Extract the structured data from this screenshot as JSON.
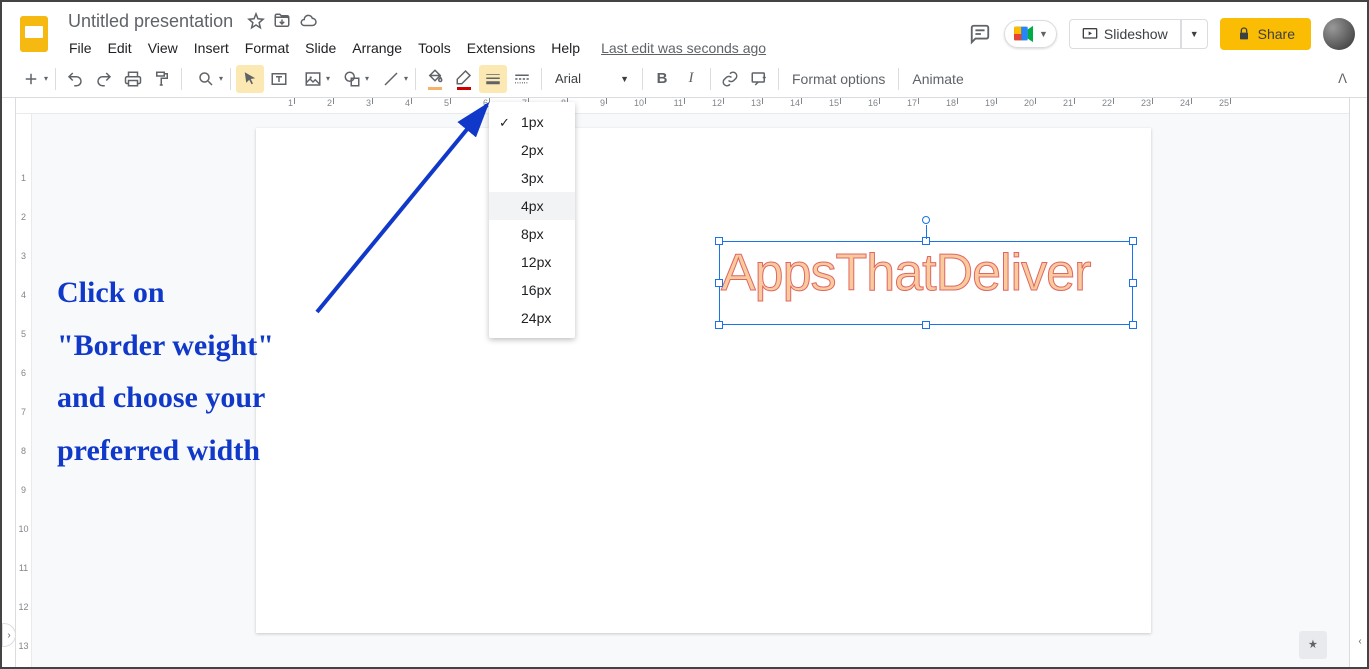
{
  "doc": {
    "title": "Untitled presentation",
    "last_edit": "Last edit was seconds ago"
  },
  "menus": [
    "File",
    "Edit",
    "View",
    "Insert",
    "Format",
    "Slide",
    "Arrange",
    "Tools",
    "Extensions",
    "Help"
  ],
  "header": {
    "slideshow": "Slideshow",
    "share": "Share"
  },
  "toolbar": {
    "font": "Arial",
    "format_options": "Format options",
    "animate": "Animate"
  },
  "border_weights": [
    "1px",
    "2px",
    "3px",
    "4px",
    "8px",
    "12px",
    "16px",
    "24px"
  ],
  "border_weight_selected": "1px",
  "border_weight_hover": "4px",
  "wordart": {
    "text": "AppsThatDeliver"
  },
  "ruler_h": [
    1,
    2,
    3,
    4,
    5,
    6,
    7,
    8,
    9,
    10,
    11,
    12,
    13,
    14,
    15,
    16,
    17,
    18,
    19,
    20,
    21,
    22,
    23,
    24,
    25
  ],
  "ruler_v": [
    1,
    2,
    3,
    4,
    5,
    6,
    7,
    8,
    9,
    10,
    11,
    12,
    13
  ],
  "annotation": {
    "l1": "Click on",
    "l2": "\"Border weight\"",
    "l3": "and choose your",
    "l4": "preferred width"
  }
}
